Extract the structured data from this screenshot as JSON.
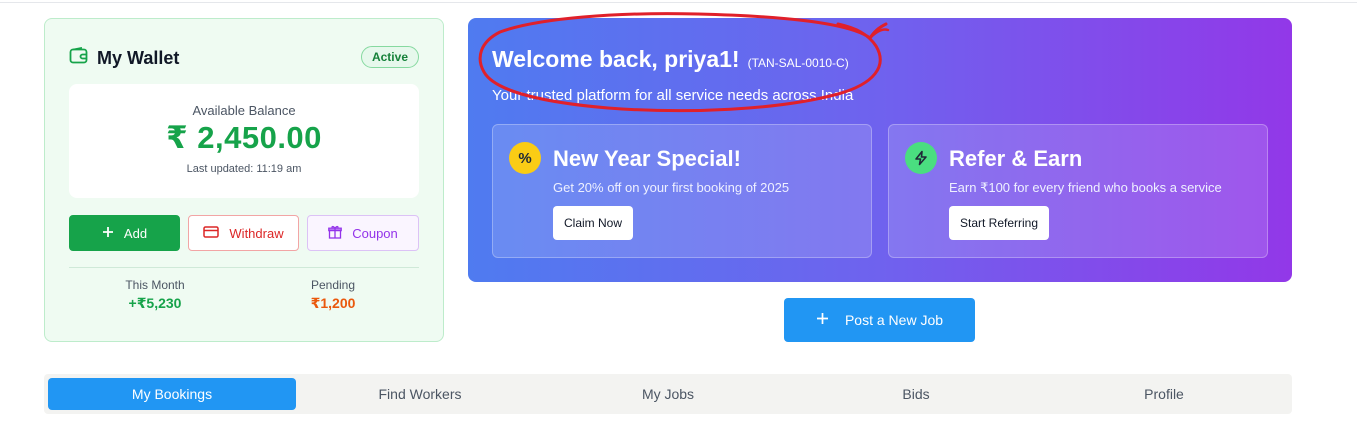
{
  "wallet": {
    "title": "My Wallet",
    "status": "Active",
    "balance_label": "Available Balance",
    "balance_value": "₹ 2,450.00",
    "last_updated": "Last updated: 11:19 am",
    "add_label": "Add",
    "withdraw_label": "Withdraw",
    "coupon_label": "Coupon",
    "stats": [
      {
        "label": "This Month",
        "value": "+₹5,230"
      },
      {
        "label": "Pending",
        "value": "₹1,200"
      }
    ],
    "colors": {
      "accent": "#16a34a",
      "pending": "#ea580c",
      "withdraw": "#dc2626",
      "coupon": "#9333ea"
    }
  },
  "hero": {
    "welcome": "Welcome back, priya1!",
    "user_code": "(TAN-SAL-0010-C)",
    "subtitle": "Your trusted platform for all service needs across India",
    "promos": [
      {
        "icon": "percent-icon",
        "title": "New Year Special!",
        "description": "Get 20% off on your first booking of 2025",
        "button": "Claim Now"
      },
      {
        "icon": "lightning-icon",
        "title": "Refer & Earn",
        "description": "Earn ₹100 for every friend who books a service",
        "button": "Start Referring"
      }
    ],
    "colors": {
      "gradient_start": "#4f7bf0",
      "gradient_end": "#9238e8",
      "annotation": "#e0202a"
    }
  },
  "post_job": {
    "label": "Post a New Job",
    "icon": "plus-icon"
  },
  "tabs": [
    {
      "label": "My Bookings",
      "active": true
    },
    {
      "label": "Find Workers",
      "active": false
    },
    {
      "label": "My Jobs",
      "active": false
    },
    {
      "label": "Bids",
      "active": false
    },
    {
      "label": "Profile",
      "active": false
    }
  ]
}
